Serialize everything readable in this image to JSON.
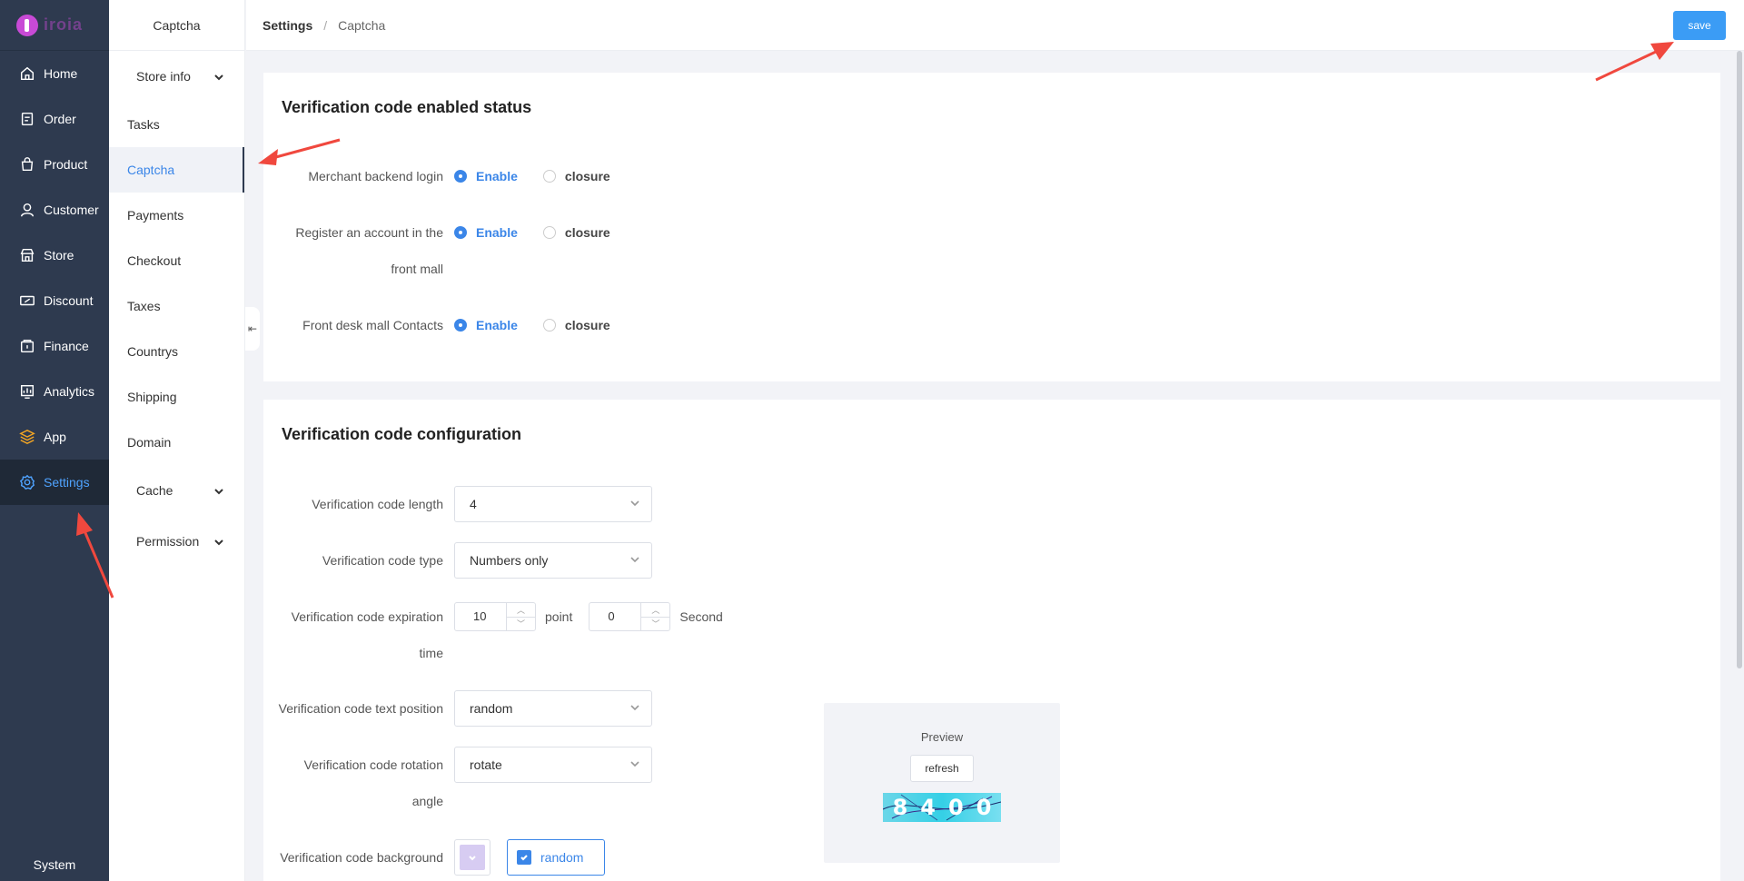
{
  "logo": {
    "wordmark": "iroia"
  },
  "rail": {
    "items": [
      {
        "label": "Home",
        "icon": "home-icon"
      },
      {
        "label": "Order",
        "icon": "order-icon"
      },
      {
        "label": "Product",
        "icon": "product-icon"
      },
      {
        "label": "Customer",
        "icon": "customer-icon"
      },
      {
        "label": "Store",
        "icon": "store-icon"
      },
      {
        "label": "Discount",
        "icon": "discount-icon"
      },
      {
        "label": "Finance",
        "icon": "finance-icon"
      },
      {
        "label": "Analytics",
        "icon": "analytics-icon"
      },
      {
        "label": "App",
        "icon": "app-icon"
      },
      {
        "label": "Settings",
        "icon": "gear-icon"
      }
    ],
    "active": "Settings",
    "bottom_label": "System"
  },
  "subbar": {
    "title": "Captcha",
    "items": [
      {
        "label": "Store info",
        "group": true
      },
      {
        "label": "Tasks"
      },
      {
        "label": "Captcha",
        "active": true
      },
      {
        "label": "Payments"
      },
      {
        "label": "Checkout"
      },
      {
        "label": "Taxes"
      },
      {
        "label": "Countrys"
      },
      {
        "label": "Shipping"
      },
      {
        "label": "Domain"
      },
      {
        "label": "Cache",
        "group": true
      },
      {
        "label": "Permission",
        "group": true
      }
    ]
  },
  "header": {
    "crumb_main": "Settings",
    "crumb_sep": "/",
    "crumb_sub": "Captcha",
    "save_label": "save"
  },
  "status_section": {
    "title": "Verification code enabled status",
    "rows": [
      {
        "label": "Merchant backend login",
        "enable": "Enable",
        "closure": "closure",
        "selected": "Enable"
      },
      {
        "label_line1": "Register an account in the",
        "label_line2": "front mall",
        "enable": "Enable",
        "closure": "closure",
        "selected": "Enable"
      },
      {
        "label": "Front desk mall Contacts",
        "enable": "Enable",
        "closure": "closure",
        "selected": "Enable"
      }
    ]
  },
  "config_section": {
    "title": "Verification code configuration",
    "length": {
      "label": "Verification code length",
      "value": "4"
    },
    "type": {
      "label": "Verification code type",
      "value": "Numbers only"
    },
    "expiration": {
      "label_line1": "Verification code expiration",
      "label_line2": "time",
      "minutes": "10",
      "minutes_unit": "point",
      "seconds": "0",
      "seconds_unit": "Second"
    },
    "position": {
      "label": "Verification code text position",
      "value": "random"
    },
    "rotation": {
      "label_line1": "Verification code rotation",
      "label_line2": "angle",
      "value": "rotate"
    },
    "background": {
      "label": "Verification code background",
      "color": "#d7ccf2",
      "random_label": "random",
      "random_checked": true
    }
  },
  "preview": {
    "title": "Preview",
    "refresh_label": "refresh",
    "captcha_text": "8400"
  },
  "colors": {
    "accent": "#3b86e8",
    "rail_bg": "#2e3a4f",
    "annotation_arrow": "#f0483e"
  }
}
